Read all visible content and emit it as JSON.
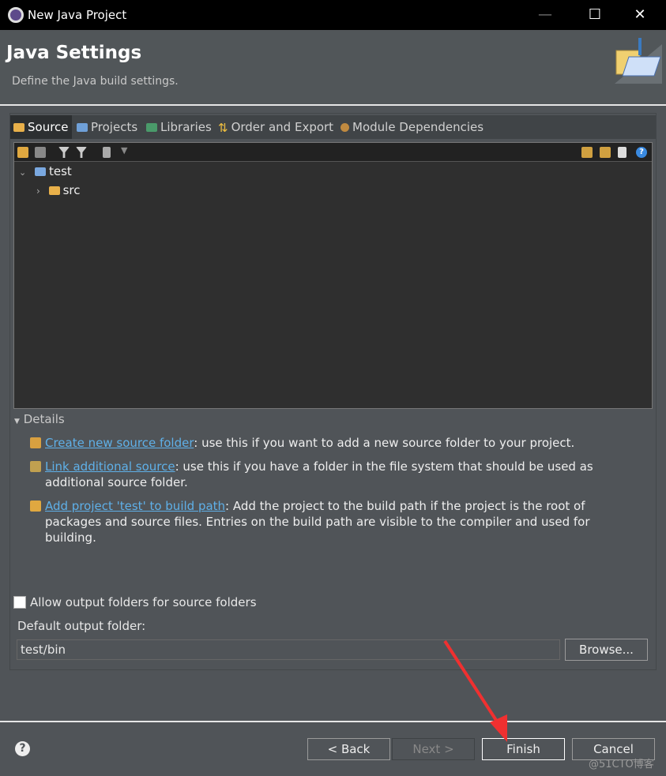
{
  "window": {
    "title": "New Java Project",
    "minimize": "—",
    "maximize": "☐",
    "close": "✕"
  },
  "header": {
    "title": "Java Settings",
    "description": "Define the Java build settings."
  },
  "tabs": [
    {
      "label": "Source",
      "selected": true
    },
    {
      "label": "Projects"
    },
    {
      "label": "Libraries"
    },
    {
      "label": "Order and Export"
    },
    {
      "label": "Module Dependencies"
    }
  ],
  "tree": {
    "project": "test",
    "folder": "src"
  },
  "details": {
    "heading": "Details",
    "items": [
      {
        "link": "Create new source folder",
        "text": ": use this if you want to add a new source folder to your project."
      },
      {
        "link": "Link additional source",
        "text": ": use this if you have a folder in the file system that should be used as additional source folder."
      },
      {
        "link": "Add project 'test' to build path",
        "text": ": Add the project to the build path if the project is the root of packages and source files. Entries on the build path are visible to the compiler and used for building."
      }
    ]
  },
  "output": {
    "allow_label": "Allow output folders for source folders",
    "allow_checked": false,
    "default_label": "Default output folder:",
    "default_value": "test/bin",
    "browse": "Browse..."
  },
  "buttons": {
    "help": "?",
    "back": "< Back",
    "next": "Next >",
    "finish": "Finish",
    "cancel": "Cancel"
  },
  "watermark": "@51CTO博客",
  "colors": {
    "link": "#5fb0e8",
    "annotation_arrow": "#f03030"
  }
}
